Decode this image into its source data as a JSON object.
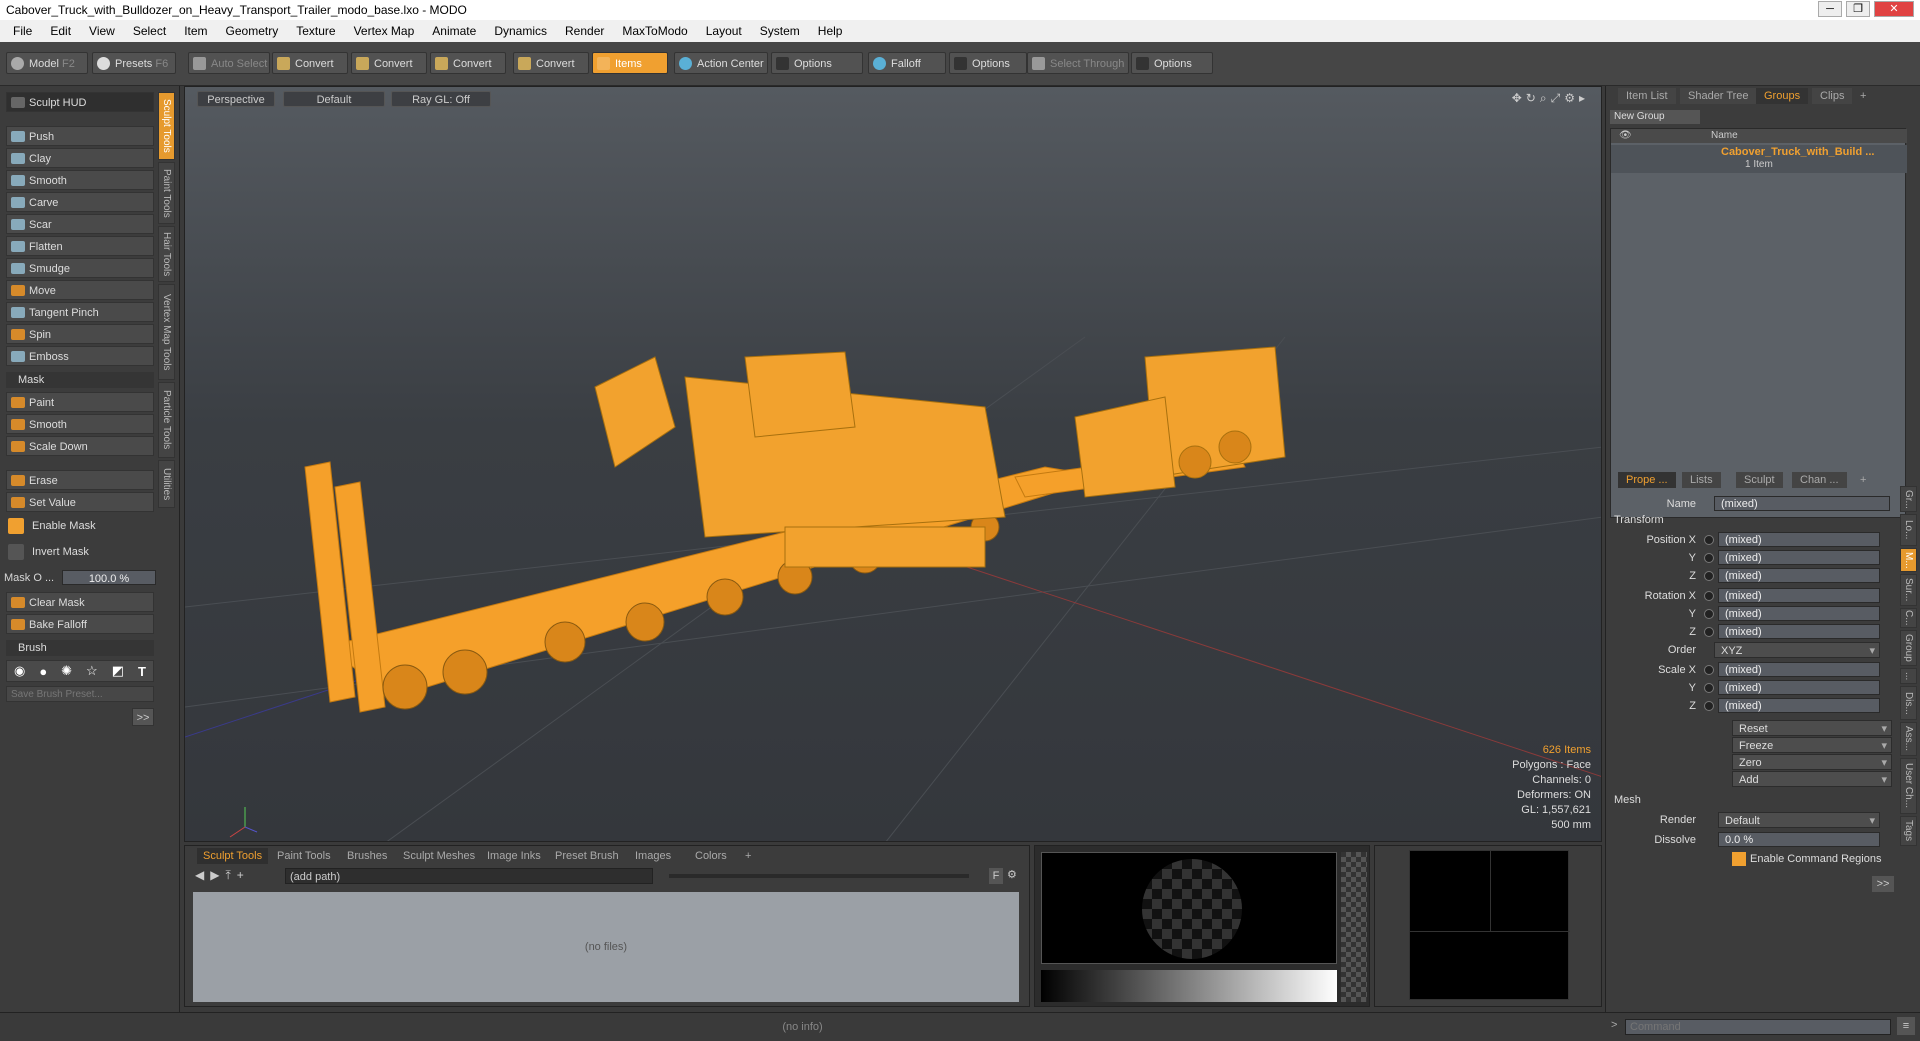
{
  "window": {
    "title": "Cabover_Truck_with_Bulldozer_on_Heavy_Transport_Trailer_modo_base.lxo - MODO",
    "min": "─",
    "max": "❐",
    "close": "✕"
  },
  "menu": [
    "File",
    "Edit",
    "View",
    "Select",
    "Item",
    "Geometry",
    "Texture",
    "Vertex Map",
    "Animate",
    "Dynamics",
    "Render",
    "MaxToModo",
    "Layout",
    "System",
    "Help"
  ],
  "toolbar": {
    "model": "Model",
    "model_key": "F2",
    "presets": "Presets",
    "presets_key": "F6",
    "auto_select": "Auto Select",
    "convert1": "Convert",
    "convert2": "Convert",
    "convert3": "Convert",
    "convert4": "Convert",
    "items": "Items",
    "action_center": "Action Center",
    "options1": "Options",
    "falloff": "Falloff",
    "options2": "Options",
    "select_through": "Select Through",
    "options3": "Options"
  },
  "left": {
    "sculpt_hud": "Sculpt HUD",
    "tools": [
      "Push",
      "Clay",
      "Smooth",
      "Carve",
      "Scar",
      "Flatten",
      "Smudge",
      "Move",
      "Tangent Pinch",
      "Spin",
      "Emboss"
    ],
    "mask_header": "Mask",
    "mask_tools": [
      "Paint",
      "Smooth",
      "Scale Down"
    ],
    "erase": "Erase",
    "set_value": "Set Value",
    "enable_mask": "Enable Mask",
    "invert_mask": "Invert Mask",
    "mask_opacity_label": "Mask O ...",
    "mask_opacity_value": "100.0 %",
    "clear_mask": "Clear Mask",
    "bake_falloff": "Bake Falloff",
    "brush_header": "Brush",
    "save_brush": "Save Brush Preset...",
    "more": ">>"
  },
  "vtabs": [
    "Sculpt Tools",
    "Paint Tools",
    "Hair Tools",
    "Vertex Map Tools",
    "Particle Tools",
    "Utilities"
  ],
  "viewport": {
    "perspective": "Perspective",
    "default": "Default",
    "raygl": "Ray GL: Off",
    "stats": {
      "items": "626 Items",
      "polygons": "Polygons : Face",
      "channels": "Channels: 0",
      "deformers": "Deformers: ON",
      "gl": "GL: 1,557,621",
      "size": "500 mm"
    }
  },
  "bottom": {
    "tabs": [
      "Sculpt Tools",
      "Paint Tools",
      "Brushes",
      "Sculpt Meshes",
      "Image Inks",
      "Preset Brush",
      "Images",
      "Colors",
      "+"
    ],
    "path": "(add path)",
    "no_files": "(no files)",
    "f_button": "F"
  },
  "right": {
    "top_tabs": [
      "Item List",
      "Shader Tree",
      "Groups",
      "Clips",
      "+"
    ],
    "new_group": "New Group",
    "name_header": "Name",
    "group_name": "Cabover_Truck_with_Build ...",
    "group_count": "1 Item",
    "prop_tabs": [
      "Prope ...",
      "Lists",
      "Sculpt",
      "Chan ...",
      "+"
    ],
    "name_label": "Name",
    "name_value": "(mixed)",
    "transform": "Transform",
    "position": [
      {
        "label": "Position X",
        "value": "(mixed)"
      },
      {
        "label": "Y",
        "value": "(mixed)"
      },
      {
        "label": "Z",
        "value": "(mixed)"
      }
    ],
    "rotation": [
      {
        "label": "Rotation X",
        "value": "(mixed)"
      },
      {
        "label": "Y",
        "value": "(mixed)"
      },
      {
        "label": "Z",
        "value": "(mixed)"
      }
    ],
    "order_label": "Order",
    "order_value": "XYZ",
    "scale": [
      {
        "label": "Scale X",
        "value": "(mixed)"
      },
      {
        "label": "Y",
        "value": "(mixed)"
      },
      {
        "label": "Z",
        "value": "(mixed)"
      }
    ],
    "reset": "Reset",
    "freeze": "Freeze",
    "zero": "Zero",
    "add": "Add",
    "mesh": "Mesh",
    "render_label": "Render",
    "render_value": "Default",
    "dissolve_label": "Dissolve",
    "dissolve_value": "0.0 %",
    "enable_cmd": "Enable Command Regions",
    "more": ">>",
    "side_tabs": [
      "Gr...",
      "Lo...",
      "M...",
      "Sur...",
      "C...",
      "Group",
      "...",
      "Dis...",
      "Ass...",
      "User Ch...",
      "Tags"
    ]
  },
  "status": {
    "info": "(no info)",
    "command_placeholder": "Command"
  }
}
